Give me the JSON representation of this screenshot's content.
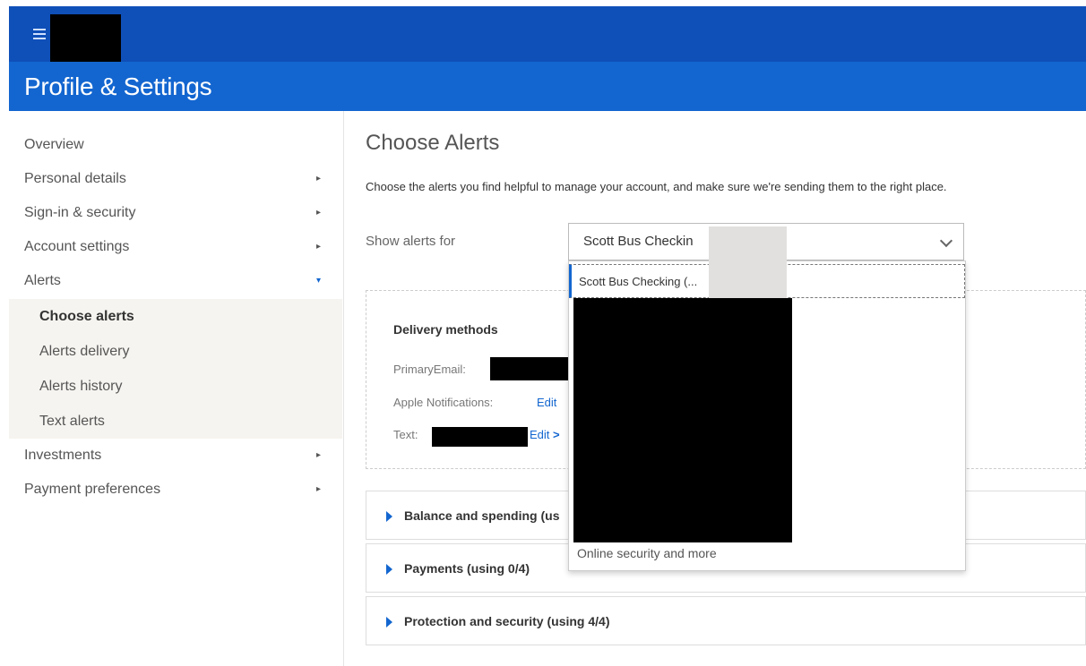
{
  "header": {
    "menu_icon": "hamburger-menu-icon",
    "title": "Profile & Settings",
    "brand_color": "#0f4fb8",
    "title_bar_color": "#1366d0"
  },
  "sidebar": {
    "items": [
      {
        "label": "Overview"
      },
      {
        "label": "Personal details",
        "arrow": "▸"
      },
      {
        "label": "Sign-in & security",
        "arrow": "▸"
      },
      {
        "label": "Account settings",
        "arrow": "▸"
      },
      {
        "label": "Alerts",
        "arrow": "▾"
      }
    ],
    "sub_items": [
      {
        "label": "Choose alerts",
        "active": true
      },
      {
        "label": "Alerts delivery"
      },
      {
        "label": "Alerts history"
      },
      {
        "label": "Text alerts"
      }
    ],
    "bottom_items": [
      {
        "label": "Investments",
        "arrow": "▸"
      },
      {
        "label": "Payment preferences",
        "arrow": "▸"
      }
    ]
  },
  "main": {
    "title": "Choose Alerts",
    "intro": "Choose the alerts you find helpful to manage your account, and make sure we're sending them to the right place.",
    "show_alerts_label": "Show alerts for",
    "account_select": {
      "value": "Scott Bus Checkin"
    },
    "dropdown": {
      "selected_option": "Scott Bus Checking (...",
      "last_option": "Online security and more"
    },
    "delivery": {
      "title": "Delivery methods",
      "primary_email_label": "PrimaryEmail:",
      "apple_label": "Apple Notifications:",
      "apple_edit": "Edit",
      "text_label": "Text:",
      "text_edit": "Edit",
      "edit_chevron": ">"
    },
    "accordions": [
      {
        "label": "Balance and spending (us"
      },
      {
        "label": "Payments (using 0/4)"
      },
      {
        "label": "Protection and security (using 4/4)"
      }
    ]
  }
}
